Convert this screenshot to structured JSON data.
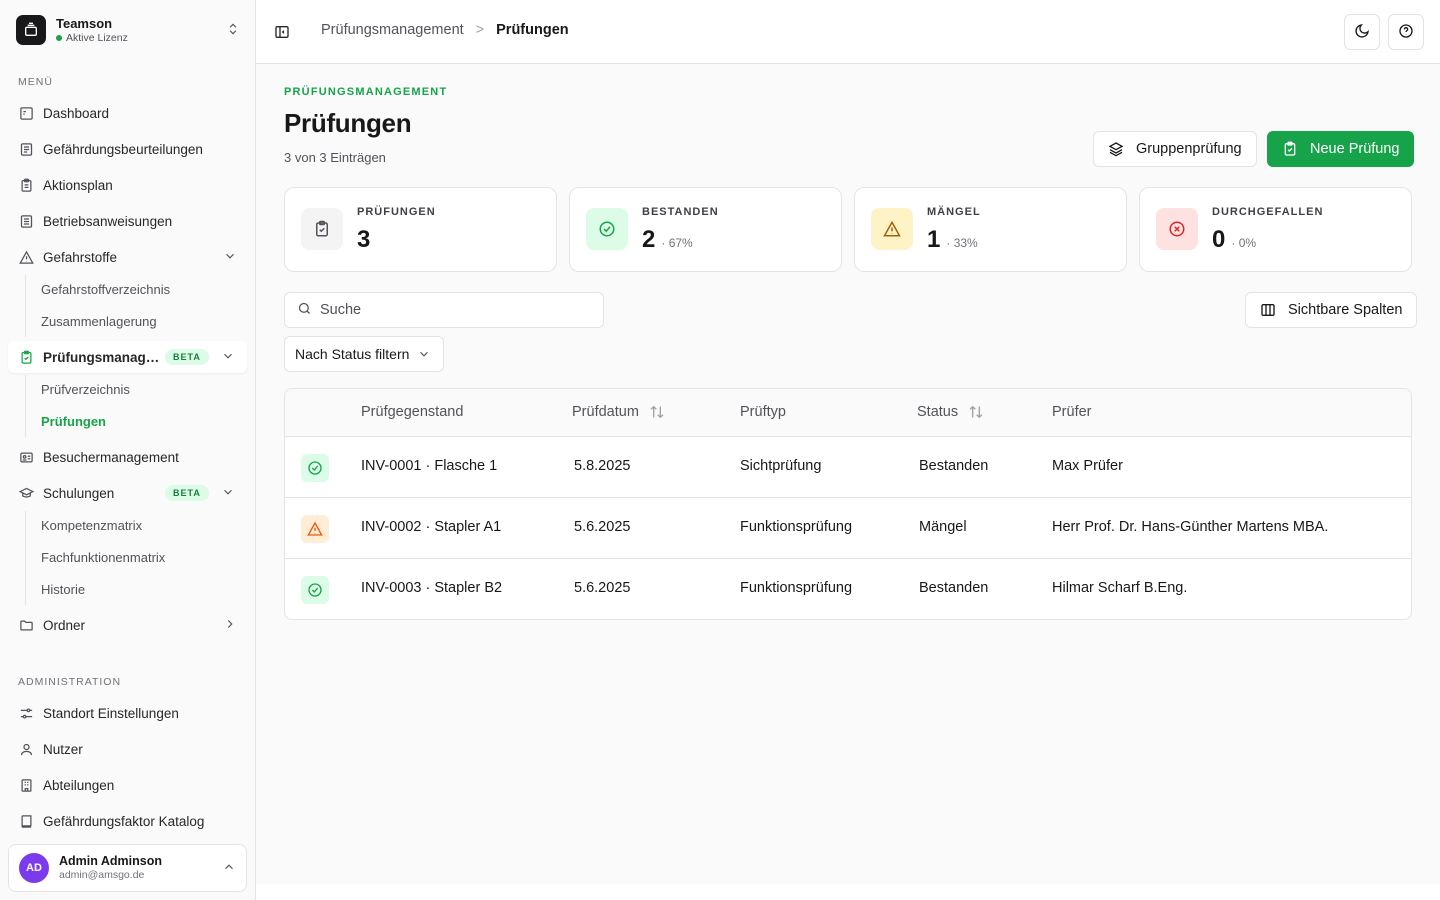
{
  "org": {
    "name": "Teamson",
    "license": "Aktive Lizenz"
  },
  "sidebar": {
    "menu_label": "MENÜ",
    "items": [
      {
        "label": "Dashboard",
        "icon": "dashboard-icon"
      },
      {
        "label": "Gefährdungsbeurteilungen",
        "icon": "document-list-icon"
      },
      {
        "label": "Aktionsplan",
        "icon": "clipboard-list-icon"
      },
      {
        "label": "Betriebsanweisungen",
        "icon": "document-icon"
      },
      {
        "label": "Gefahrstoffe",
        "icon": "warning-icon",
        "children": [
          {
            "label": "Gefahrstoffverzeichnis"
          },
          {
            "label": "Zusammenlagerung"
          }
        ]
      },
      {
        "label": "Prüfungsmanagement",
        "icon": "clipboard-check-icon",
        "badge": "BETA",
        "children": [
          {
            "label": "Prüfverzeichnis"
          },
          {
            "label": "Prüfungen"
          }
        ]
      },
      {
        "label": "Besuchermanagement",
        "icon": "id-card-icon"
      },
      {
        "label": "Schulungen",
        "icon": "graduation-cap-icon",
        "badge": "BETA",
        "children": [
          {
            "label": "Kompetenzmatrix"
          },
          {
            "label": "Fachfunktionenmatrix"
          },
          {
            "label": "Historie"
          }
        ]
      },
      {
        "label": "Ordner",
        "icon": "folder-icon"
      }
    ],
    "admin_label": "ADMINISTRATION",
    "admin_items": [
      {
        "label": "Standort Einstellungen",
        "icon": "sliders-icon"
      },
      {
        "label": "Nutzer",
        "icon": "user-icon"
      },
      {
        "label": "Abteilungen",
        "icon": "building-icon"
      },
      {
        "label": "Gefährdungsfaktor Katalog",
        "icon": "book-icon"
      }
    ]
  },
  "user": {
    "initials": "AD",
    "name": "Admin Adminson",
    "email": "admin@amsgo.de"
  },
  "breadcrumb": {
    "parent": "Prüfungsmanagement",
    "separator": ">",
    "current": "Prüfungen"
  },
  "page": {
    "eyebrow": "PRÜFUNGSMANAGEMENT",
    "title": "Prüfungen",
    "subtitle": "3 von 3 Einträgen",
    "group_button": "Gruppenprüfung",
    "new_button": "Neue Prüfung"
  },
  "stats": [
    {
      "label": "PRÜFUNGEN",
      "value": "3",
      "pct": "",
      "icon": "clipboard-check-icon",
      "bg": "#f4f4f5",
      "fg": "#52525b"
    },
    {
      "label": "BESTANDEN",
      "value": "2",
      "pct": "· 67%",
      "icon": "check-circle-icon",
      "bg": "#dcfce7",
      "fg": "#16a34a"
    },
    {
      "label": "MÄNGEL",
      "value": "1",
      "pct": "· 33%",
      "icon": "warning-icon",
      "bg": "#fef3c7",
      "fg": "#a16207"
    },
    {
      "label": "DURCHGEFALLEN",
      "value": "0",
      "pct": "· 0%",
      "icon": "x-circle-icon",
      "bg": "#fee2e2",
      "fg": "#dc2626"
    }
  ],
  "search": {
    "placeholder": "Suche"
  },
  "filter": {
    "label": "Nach Status filtern"
  },
  "columns_button": "Sichtbare Spalten",
  "table": {
    "headers": [
      "Prüfgegenstand",
      "Prüfdatum",
      "Prüftyp",
      "Status",
      "Prüfer"
    ],
    "rows": [
      {
        "status_icon": "check-circle-icon",
        "object": "INV-0001 · Flasche 1",
        "date": "5.8.2025",
        "type": "Sichtprüfung",
        "status": "Bestanden",
        "inspector": "Max Prüfer"
      },
      {
        "status_icon": "warning-icon",
        "object": "INV-0002 · Stapler A1",
        "date": "5.6.2025",
        "type": "Funktionsprüfung",
        "status": "Mängel",
        "inspector": "Herr Prof. Dr. Hans-Günther Martens MBA."
      },
      {
        "status_icon": "check-circle-icon",
        "object": "INV-0003 · Stapler B2",
        "date": "5.6.2025",
        "type": "Funktionsprüfung",
        "status": "Bestanden",
        "inspector": "Hilmar Scharf B.Eng."
      }
    ]
  },
  "colors": {
    "accent": "#16a34a",
    "border": "#e4e4e7",
    "avatar": "#7c3aed"
  }
}
